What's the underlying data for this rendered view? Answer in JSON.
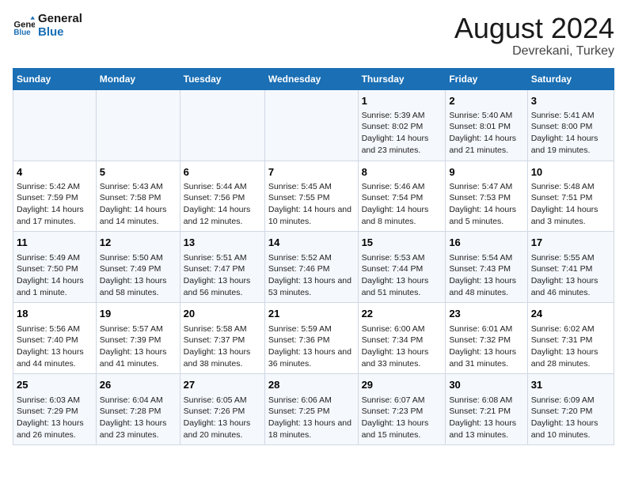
{
  "header": {
    "logo_line1": "General",
    "logo_line2": "Blue",
    "title": "August 2024",
    "subtitle": "Devrekani, Turkey"
  },
  "weekdays": [
    "Sunday",
    "Monday",
    "Tuesday",
    "Wednesday",
    "Thursday",
    "Friday",
    "Saturday"
  ],
  "weeks": [
    [
      {
        "day": "",
        "info": ""
      },
      {
        "day": "",
        "info": ""
      },
      {
        "day": "",
        "info": ""
      },
      {
        "day": "",
        "info": ""
      },
      {
        "day": "1",
        "info": "Sunrise: 5:39 AM\nSunset: 8:02 PM\nDaylight: 14 hours and 23 minutes."
      },
      {
        "day": "2",
        "info": "Sunrise: 5:40 AM\nSunset: 8:01 PM\nDaylight: 14 hours and 21 minutes."
      },
      {
        "day": "3",
        "info": "Sunrise: 5:41 AM\nSunset: 8:00 PM\nDaylight: 14 hours and 19 minutes."
      }
    ],
    [
      {
        "day": "4",
        "info": "Sunrise: 5:42 AM\nSunset: 7:59 PM\nDaylight: 14 hours and 17 minutes."
      },
      {
        "day": "5",
        "info": "Sunrise: 5:43 AM\nSunset: 7:58 PM\nDaylight: 14 hours and 14 minutes."
      },
      {
        "day": "6",
        "info": "Sunrise: 5:44 AM\nSunset: 7:56 PM\nDaylight: 14 hours and 12 minutes."
      },
      {
        "day": "7",
        "info": "Sunrise: 5:45 AM\nSunset: 7:55 PM\nDaylight: 14 hours and 10 minutes."
      },
      {
        "day": "8",
        "info": "Sunrise: 5:46 AM\nSunset: 7:54 PM\nDaylight: 14 hours and 8 minutes."
      },
      {
        "day": "9",
        "info": "Sunrise: 5:47 AM\nSunset: 7:53 PM\nDaylight: 14 hours and 5 minutes."
      },
      {
        "day": "10",
        "info": "Sunrise: 5:48 AM\nSunset: 7:51 PM\nDaylight: 14 hours and 3 minutes."
      }
    ],
    [
      {
        "day": "11",
        "info": "Sunrise: 5:49 AM\nSunset: 7:50 PM\nDaylight: 14 hours and 1 minute."
      },
      {
        "day": "12",
        "info": "Sunrise: 5:50 AM\nSunset: 7:49 PM\nDaylight: 13 hours and 58 minutes."
      },
      {
        "day": "13",
        "info": "Sunrise: 5:51 AM\nSunset: 7:47 PM\nDaylight: 13 hours and 56 minutes."
      },
      {
        "day": "14",
        "info": "Sunrise: 5:52 AM\nSunset: 7:46 PM\nDaylight: 13 hours and 53 minutes."
      },
      {
        "day": "15",
        "info": "Sunrise: 5:53 AM\nSunset: 7:44 PM\nDaylight: 13 hours and 51 minutes."
      },
      {
        "day": "16",
        "info": "Sunrise: 5:54 AM\nSunset: 7:43 PM\nDaylight: 13 hours and 48 minutes."
      },
      {
        "day": "17",
        "info": "Sunrise: 5:55 AM\nSunset: 7:41 PM\nDaylight: 13 hours and 46 minutes."
      }
    ],
    [
      {
        "day": "18",
        "info": "Sunrise: 5:56 AM\nSunset: 7:40 PM\nDaylight: 13 hours and 44 minutes."
      },
      {
        "day": "19",
        "info": "Sunrise: 5:57 AM\nSunset: 7:39 PM\nDaylight: 13 hours and 41 minutes."
      },
      {
        "day": "20",
        "info": "Sunrise: 5:58 AM\nSunset: 7:37 PM\nDaylight: 13 hours and 38 minutes."
      },
      {
        "day": "21",
        "info": "Sunrise: 5:59 AM\nSunset: 7:36 PM\nDaylight: 13 hours and 36 minutes."
      },
      {
        "day": "22",
        "info": "Sunrise: 6:00 AM\nSunset: 7:34 PM\nDaylight: 13 hours and 33 minutes."
      },
      {
        "day": "23",
        "info": "Sunrise: 6:01 AM\nSunset: 7:32 PM\nDaylight: 13 hours and 31 minutes."
      },
      {
        "day": "24",
        "info": "Sunrise: 6:02 AM\nSunset: 7:31 PM\nDaylight: 13 hours and 28 minutes."
      }
    ],
    [
      {
        "day": "25",
        "info": "Sunrise: 6:03 AM\nSunset: 7:29 PM\nDaylight: 13 hours and 26 minutes."
      },
      {
        "day": "26",
        "info": "Sunrise: 6:04 AM\nSunset: 7:28 PM\nDaylight: 13 hours and 23 minutes."
      },
      {
        "day": "27",
        "info": "Sunrise: 6:05 AM\nSunset: 7:26 PM\nDaylight: 13 hours and 20 minutes."
      },
      {
        "day": "28",
        "info": "Sunrise: 6:06 AM\nSunset: 7:25 PM\nDaylight: 13 hours and 18 minutes."
      },
      {
        "day": "29",
        "info": "Sunrise: 6:07 AM\nSunset: 7:23 PM\nDaylight: 13 hours and 15 minutes."
      },
      {
        "day": "30",
        "info": "Sunrise: 6:08 AM\nSunset: 7:21 PM\nDaylight: 13 hours and 13 minutes."
      },
      {
        "day": "31",
        "info": "Sunrise: 6:09 AM\nSunset: 7:20 PM\nDaylight: 13 hours and 10 minutes."
      }
    ]
  ]
}
